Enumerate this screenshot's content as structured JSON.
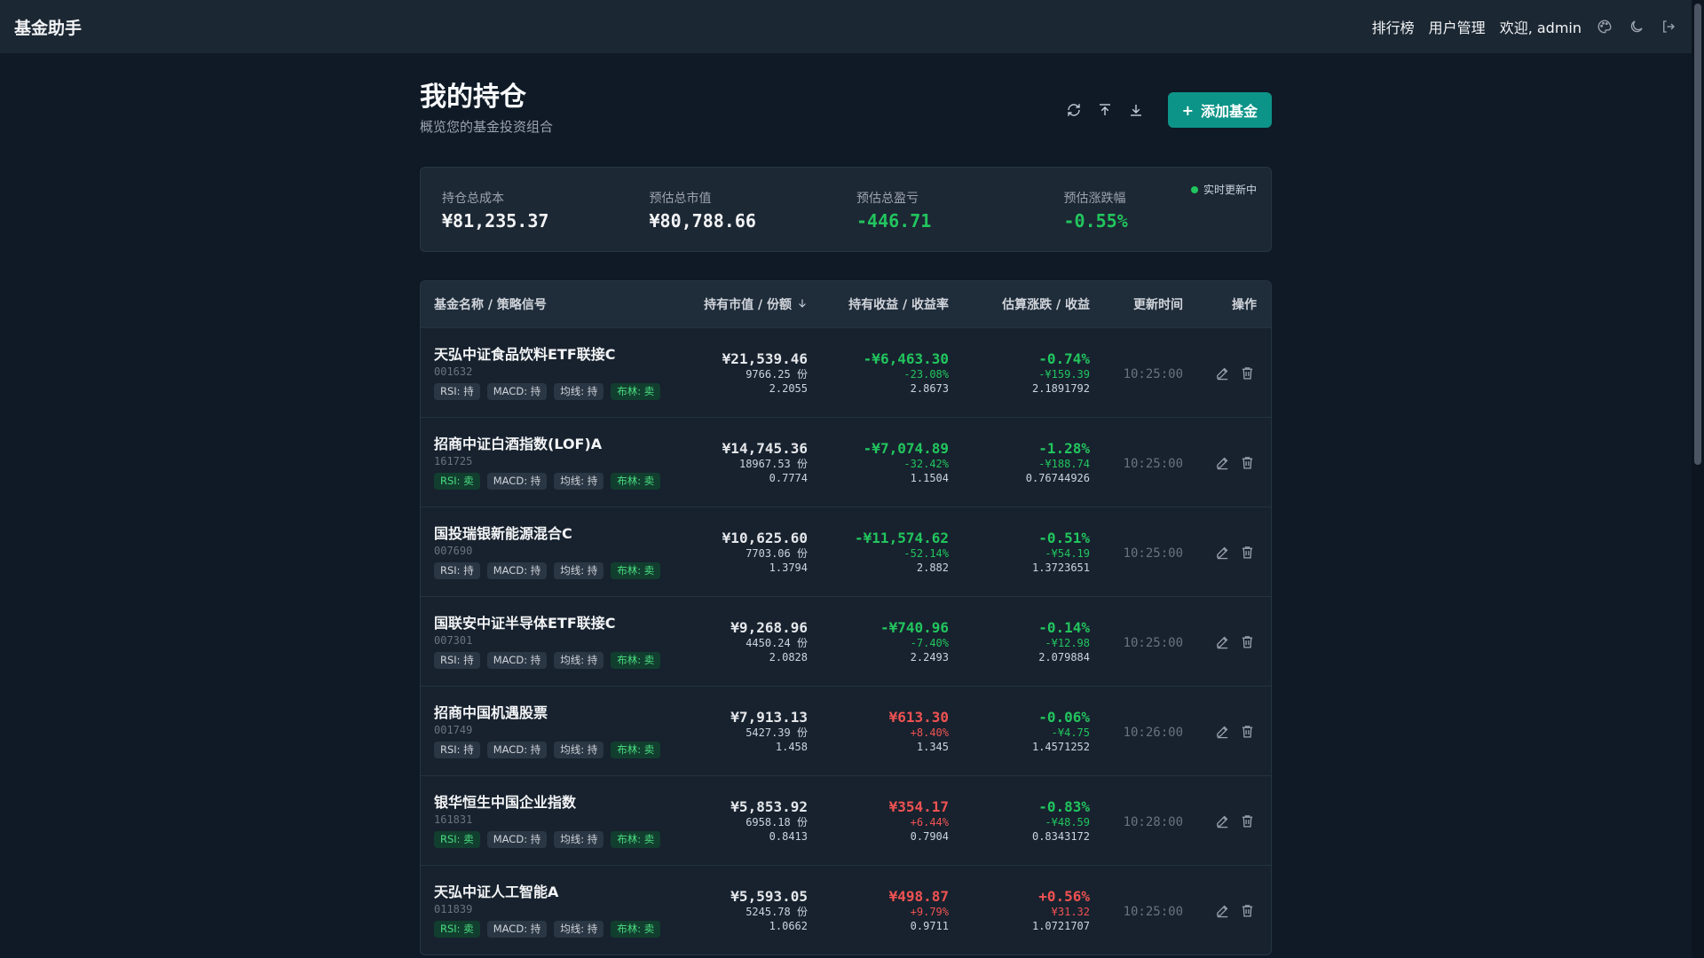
{
  "nav": {
    "brand": "基金助手",
    "links": [
      "排行榜",
      "用户管理"
    ],
    "welcome": "欢迎, admin",
    "icons": [
      "palette-icon",
      "moon-icon",
      "logout-icon"
    ]
  },
  "header": {
    "title": "我的持仓",
    "subtitle": "概览您的基金投资组合",
    "add_button": "添加基金",
    "icons": [
      "refresh-icon",
      "upload-icon",
      "download-icon"
    ]
  },
  "summary": {
    "live_label": "实时更新中",
    "items": [
      {
        "label": "持仓总成本",
        "value": "¥81,235.37",
        "tone": "neutral"
      },
      {
        "label": "预估总市值",
        "value": "¥80,788.66",
        "tone": "neutral"
      },
      {
        "label": "预估总盈亏",
        "value": "-446.71",
        "tone": "green"
      },
      {
        "label": "预估涨跌幅",
        "value": "-0.55%",
        "tone": "green"
      }
    ]
  },
  "table": {
    "headers": [
      "基金名称 / 策略信号",
      "持有市值 / 份额",
      "持有收益 / 收益率",
      "估算涨跌 / 收益",
      "更新时间",
      "操作"
    ],
    "rows": [
      {
        "name": "天弘中证食品饮料ETF联接C",
        "code": "001632",
        "tags": [
          {
            "t": "RSI: 持",
            "s": false
          },
          {
            "t": "MACD: 持",
            "s": false
          },
          {
            "t": "均线: 持",
            "s": false
          },
          {
            "t": "布林: 卖",
            "s": true
          }
        ],
        "mv": "¥21,539.46",
        "shares": "9766.25 份",
        "cost": "2.2055",
        "pl": "-¥6,463.30",
        "pl_rate": "-23.08%",
        "pl_nav": "2.8673",
        "pl_tone": "green",
        "est": "-0.74%",
        "est_amt": "-¥159.39",
        "est_nav": "2.1891792",
        "est_tone": "green",
        "time": "10:25:00"
      },
      {
        "name": "招商中证白酒指数(LOF)A",
        "code": "161725",
        "tags": [
          {
            "t": "RSI: 卖",
            "s": true
          },
          {
            "t": "MACD: 持",
            "s": false
          },
          {
            "t": "均线: 持",
            "s": false
          },
          {
            "t": "布林: 卖",
            "s": true
          }
        ],
        "mv": "¥14,745.36",
        "shares": "18967.53 份",
        "cost": "0.7774",
        "pl": "-¥7,074.89",
        "pl_rate": "-32.42%",
        "pl_nav": "1.1504",
        "pl_tone": "green",
        "est": "-1.28%",
        "est_amt": "-¥188.74",
        "est_nav": "0.76744926",
        "est_tone": "green",
        "time": "10:25:00"
      },
      {
        "name": "国投瑞银新能源混合C",
        "code": "007690",
        "tags": [
          {
            "t": "RSI: 持",
            "s": false
          },
          {
            "t": "MACD: 持",
            "s": false
          },
          {
            "t": "均线: 持",
            "s": false
          },
          {
            "t": "布林: 卖",
            "s": true
          }
        ],
        "mv": "¥10,625.60",
        "shares": "7703.06 份",
        "cost": "1.3794",
        "pl": "-¥11,574.62",
        "pl_rate": "-52.14%",
        "pl_nav": "2.882",
        "pl_tone": "green",
        "est": "-0.51%",
        "est_amt": "-¥54.19",
        "est_nav": "1.3723651",
        "est_tone": "green",
        "time": "10:25:00"
      },
      {
        "name": "国联安中证半导体ETF联接C",
        "code": "007301",
        "tags": [
          {
            "t": "RSI: 持",
            "s": false
          },
          {
            "t": "MACD: 持",
            "s": false
          },
          {
            "t": "均线: 持",
            "s": false
          },
          {
            "t": "布林: 卖",
            "s": true
          }
        ],
        "mv": "¥9,268.96",
        "shares": "4450.24 份",
        "cost": "2.0828",
        "pl": "-¥740.96",
        "pl_rate": "-7.40%",
        "pl_nav": "2.2493",
        "pl_tone": "green",
        "est": "-0.14%",
        "est_amt": "-¥12.98",
        "est_nav": "2.079884",
        "est_tone": "green",
        "time": "10:25:00"
      },
      {
        "name": "招商中国机遇股票",
        "code": "001749",
        "tags": [
          {
            "t": "RSI: 持",
            "s": false
          },
          {
            "t": "MACD: 持",
            "s": false
          },
          {
            "t": "均线: 持",
            "s": false
          },
          {
            "t": "布林: 卖",
            "s": true
          }
        ],
        "mv": "¥7,913.13",
        "shares": "5427.39 份",
        "cost": "1.458",
        "pl": "¥613.30",
        "pl_rate": "+8.40%",
        "pl_nav": "1.345",
        "pl_tone": "red",
        "est": "-0.06%",
        "est_amt": "-¥4.75",
        "est_nav": "1.4571252",
        "est_tone": "green",
        "time": "10:26:00"
      },
      {
        "name": "银华恒生中国企业指数",
        "code": "161831",
        "tags": [
          {
            "t": "RSI: 卖",
            "s": true
          },
          {
            "t": "MACD: 持",
            "s": false
          },
          {
            "t": "均线: 持",
            "s": false
          },
          {
            "t": "布林: 卖",
            "s": true
          }
        ],
        "mv": "¥5,853.92",
        "shares": "6958.18 份",
        "cost": "0.8413",
        "pl": "¥354.17",
        "pl_rate": "+6.44%",
        "pl_nav": "0.7904",
        "pl_tone": "red",
        "est": "-0.83%",
        "est_amt": "-¥48.59",
        "est_nav": "0.8343172",
        "est_tone": "green",
        "time": "10:28:00"
      },
      {
        "name": "天弘中证人工智能A",
        "code": "011839",
        "tags": [
          {
            "t": "RSI: 卖",
            "s": true
          },
          {
            "t": "MACD: 持",
            "s": false
          },
          {
            "t": "均线: 持",
            "s": false
          },
          {
            "t": "布林: 卖",
            "s": true
          }
        ],
        "mv": "¥5,593.05",
        "shares": "5245.78 份",
        "cost": "1.0662",
        "pl": "¥498.87",
        "pl_rate": "+9.79%",
        "pl_nav": "0.9711",
        "pl_tone": "red",
        "est": "+0.56%",
        "est_amt": "¥31.32",
        "est_nav": "1.0721707",
        "est_tone": "red",
        "time": "10:25:00"
      }
    ]
  },
  "colors": {
    "accent": "#0d9488",
    "gain": "#f05252",
    "loss": "#22c55e"
  }
}
